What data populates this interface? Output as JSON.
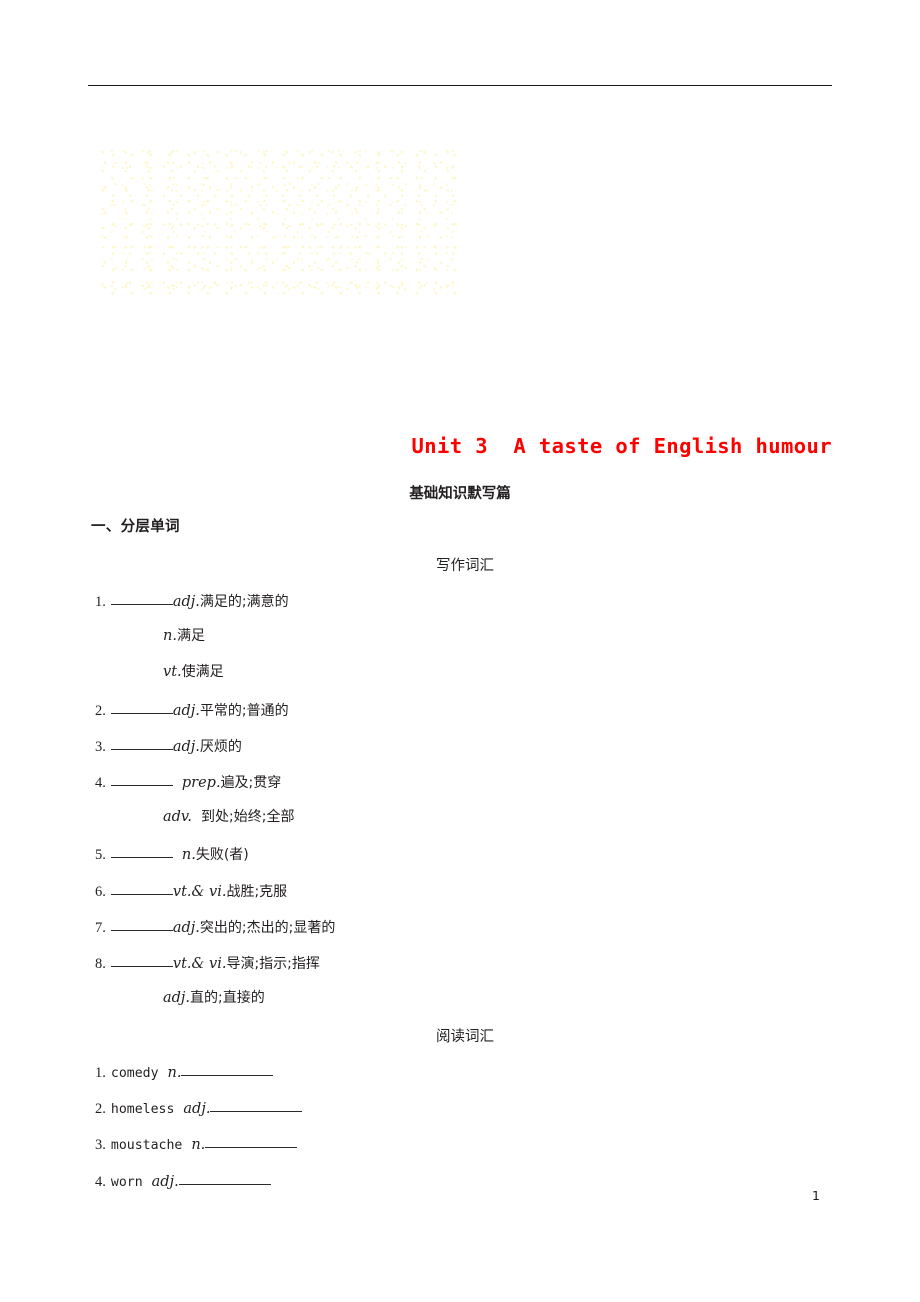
{
  "document": {
    "unit_title": "Unit 3  A taste of English humour",
    "unit_title_color": "#ff0000",
    "main_caption": "基础知识默写篇",
    "section_heading": "一、分层单词",
    "page_number": "1"
  },
  "writing_vocabulary": {
    "caption": "写作词汇",
    "entries": [
      {
        "number": "1.",
        "lines": [
          {
            "blank": true,
            "blank_width": 62,
            "gap": false,
            "pos": "adj.",
            "meaning": "满足的;满意的"
          },
          {
            "blank": false,
            "pos": "n.",
            "meaning": "满足"
          },
          {
            "blank": false,
            "pos": "vt.",
            "meaning": "使满足"
          }
        ]
      },
      {
        "number": "2.",
        "lines": [
          {
            "blank": true,
            "blank_width": 62,
            "gap": false,
            "pos": "adj.",
            "meaning": "平常的;普通的"
          }
        ]
      },
      {
        "number": "3.",
        "lines": [
          {
            "blank": true,
            "blank_width": 62,
            "gap": false,
            "pos": "adj.",
            "meaning": "厌烦的"
          }
        ]
      },
      {
        "number": "4.",
        "lines": [
          {
            "blank": true,
            "blank_width": 62,
            "gap": true,
            "pos": "prep.",
            "meaning": "遍及;贯穿"
          },
          {
            "blank": false,
            "pos": "adv.",
            "meaning": "到处;始终;全部",
            "pos_gap": true
          }
        ]
      },
      {
        "number": "5.",
        "lines": [
          {
            "blank": true,
            "blank_width": 62,
            "gap": true,
            "pos": "n.",
            "meaning": "失败(者)"
          }
        ]
      },
      {
        "number": "6.",
        "lines": [
          {
            "blank": true,
            "blank_width": 62,
            "gap": false,
            "pos": "vt.& vi.",
            "meaning": "战胜;克服"
          }
        ]
      },
      {
        "number": "7.",
        "lines": [
          {
            "blank": true,
            "blank_width": 62,
            "gap": false,
            "pos": "adj.",
            "meaning": "突出的;杰出的;显著的"
          }
        ]
      },
      {
        "number": "8.",
        "lines": [
          {
            "blank": true,
            "blank_width": 62,
            "gap": false,
            "pos": "vt.& vi.",
            "meaning": "导演;指示;指挥"
          },
          {
            "blank": false,
            "pos": "adj.",
            "meaning": "直的;直接的"
          }
        ]
      }
    ]
  },
  "reading_vocabulary": {
    "caption": "阅读词汇",
    "entries": [
      {
        "number": "1.",
        "word": "comedy",
        "pos": "n.",
        "blank_width": 92
      },
      {
        "number": "2.",
        "word": "homeless",
        "pos": "adj.",
        "blank_width": 92
      },
      {
        "number": "3.",
        "word": "moustache",
        "pos": "n.",
        "blank_width": 92
      },
      {
        "number": "4.",
        "word": "worn",
        "pos": "adj.",
        "blank_width": 92
      }
    ]
  }
}
